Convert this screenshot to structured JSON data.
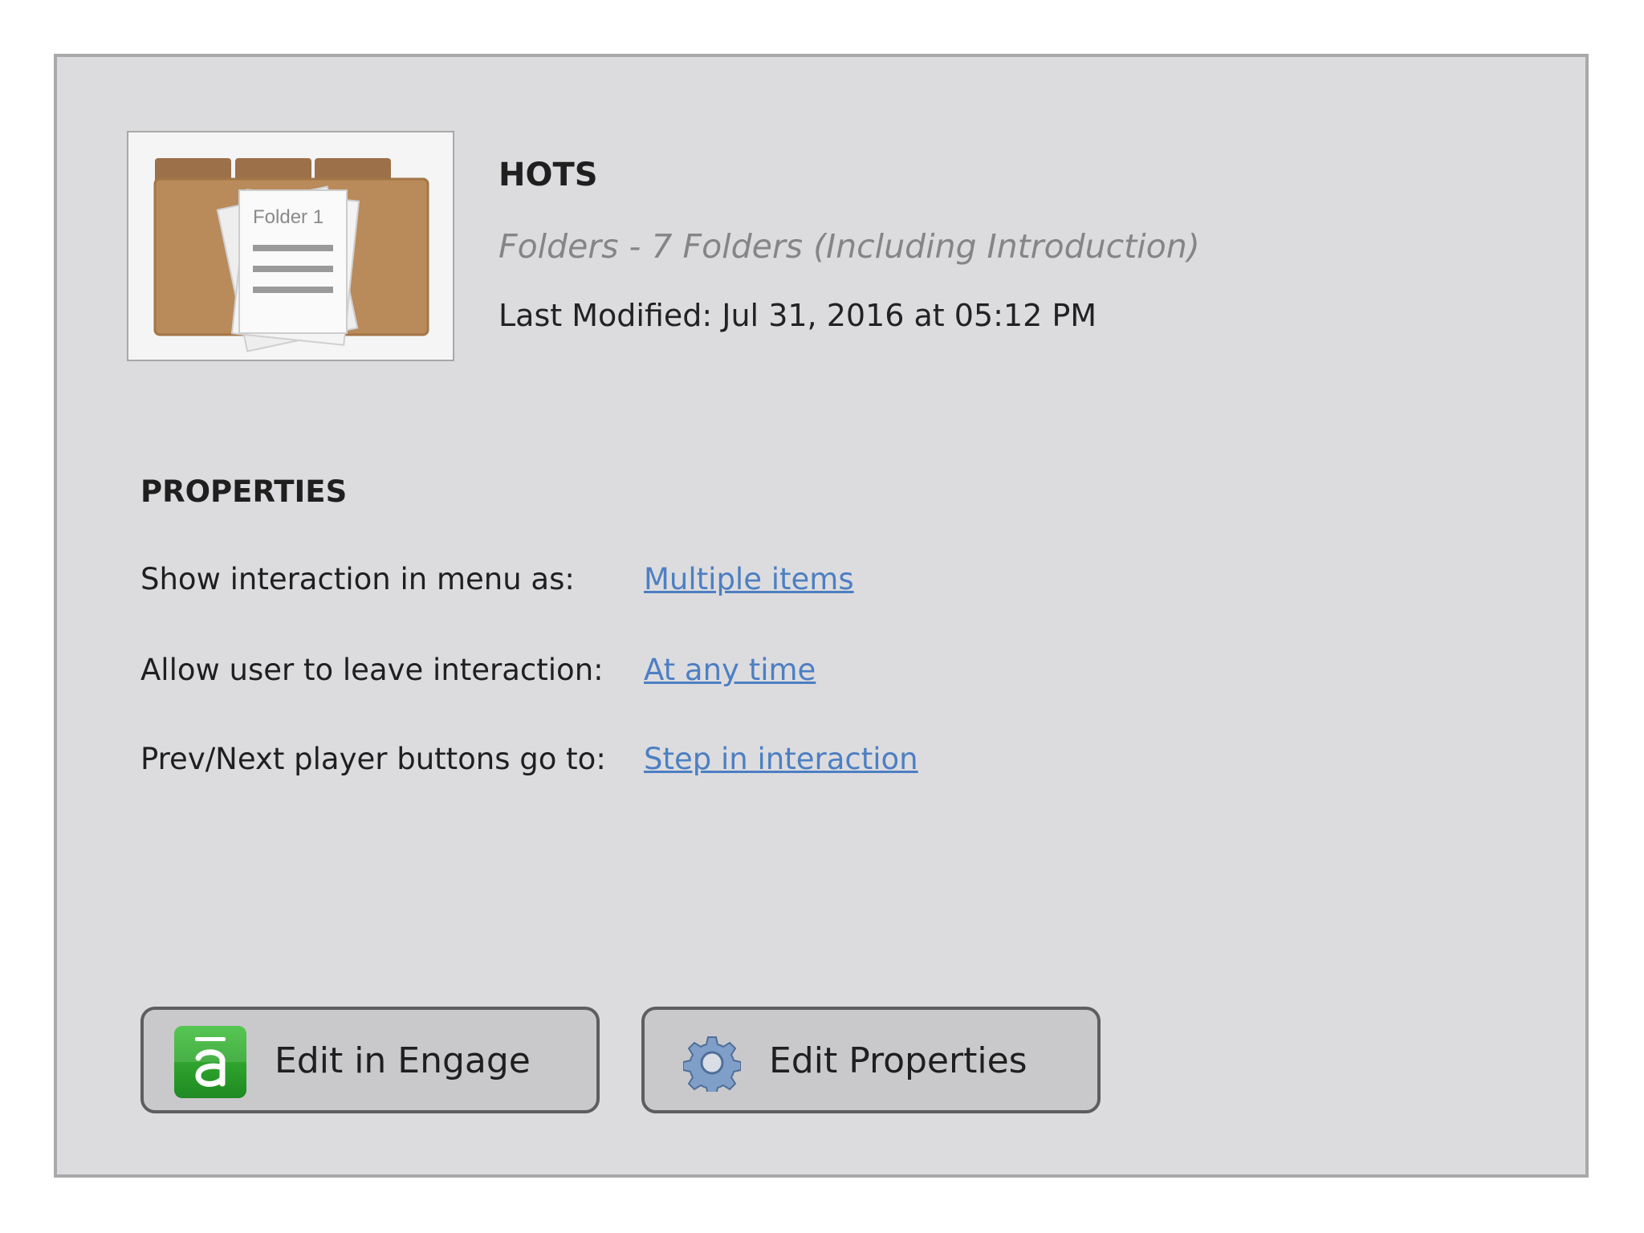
{
  "interaction": {
    "title": "HOTS",
    "subtitle": "Folders - 7 Folders (Including Introduction)",
    "last_modified": "Last Modified: Jul 31, 2016 at 05:12 PM",
    "thumbnail": {
      "icon": "folder-icon",
      "page_label": "Folder 1"
    }
  },
  "properties": {
    "heading": "PROPERTIES",
    "rows": [
      {
        "label": "Show interaction in menu as:",
        "value": "Multiple items"
      },
      {
        "label": "Allow user to leave interaction:",
        "value": "At any time"
      },
      {
        "label": "Prev/Next player buttons go to:",
        "value": "Step in interaction"
      }
    ]
  },
  "buttons": {
    "edit_engage": {
      "label": "Edit in Engage",
      "icon": "engage-icon"
    },
    "edit_properties": {
      "label": "Edit Properties",
      "icon": "gear-icon"
    }
  },
  "colors": {
    "panel_background": "#dcdcdf",
    "link": "#4d7fc2",
    "engage_green": "#2fa82d",
    "folder_brown": "#b98a5a"
  }
}
